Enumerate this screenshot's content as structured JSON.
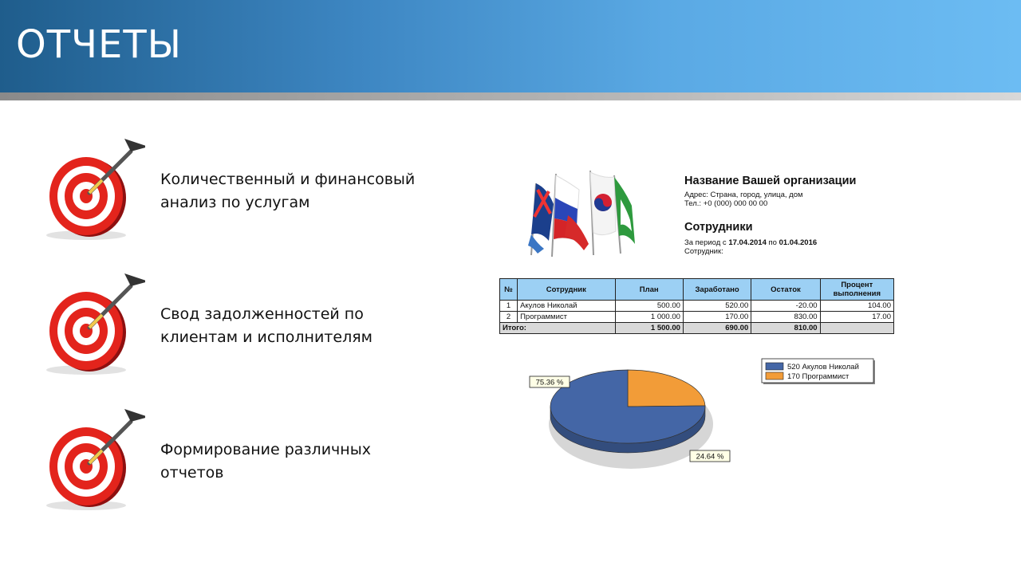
{
  "slide": {
    "title": "ОТЧЕТЫ"
  },
  "bullets": [
    {
      "line1": "Количественный и финансовый",
      "line2": "анализ по услугам"
    },
    {
      "line1": "Свод задолженностей по",
      "line2": "клиентам и исполнителям"
    },
    {
      "line1": "Формирование различных",
      "line2": "отчетов"
    }
  ],
  "report": {
    "org_name": "Название Вашей организации",
    "address": "Адрес: Страна, город, улица, дом",
    "phone": "Тел.: +0 (000) 000 00 00",
    "title": "Сотрудники",
    "period_prefix": "За период с ",
    "period_from": "17.04.2014",
    "period_mid": " по ",
    "period_to": "01.04.2016",
    "employee_label": "Сотрудник:",
    "table": {
      "headers": [
        "№",
        "Сотрудник",
        "План",
        "Заработано",
        "Остаток",
        "Процент выполнения"
      ],
      "rows": [
        [
          "1",
          "Акулов Николай",
          "500.00",
          "520.00",
          "-20.00",
          "104.00"
        ],
        [
          "2",
          "Программист",
          "1 000.00",
          "170.00",
          "830.00",
          "17.00"
        ]
      ],
      "total": [
        "Итого:",
        "1 500.00",
        "690.00",
        "810.00",
        ""
      ]
    },
    "chart_data": {
      "type": "pie",
      "slices": [
        {
          "label": "520 Акулов Николай",
          "value": 520,
          "percent_label": "75.36 %",
          "color": "#4466a6"
        },
        {
          "label": "170 Программист",
          "value": 170,
          "percent_label": "24.64 %",
          "color": "#f29c38"
        }
      ],
      "legend_position": "top-right"
    }
  },
  "colors": {
    "header_dark": "#1f5d8c",
    "header_light": "#6cbcf3",
    "table_header": "#9cd0f4"
  }
}
